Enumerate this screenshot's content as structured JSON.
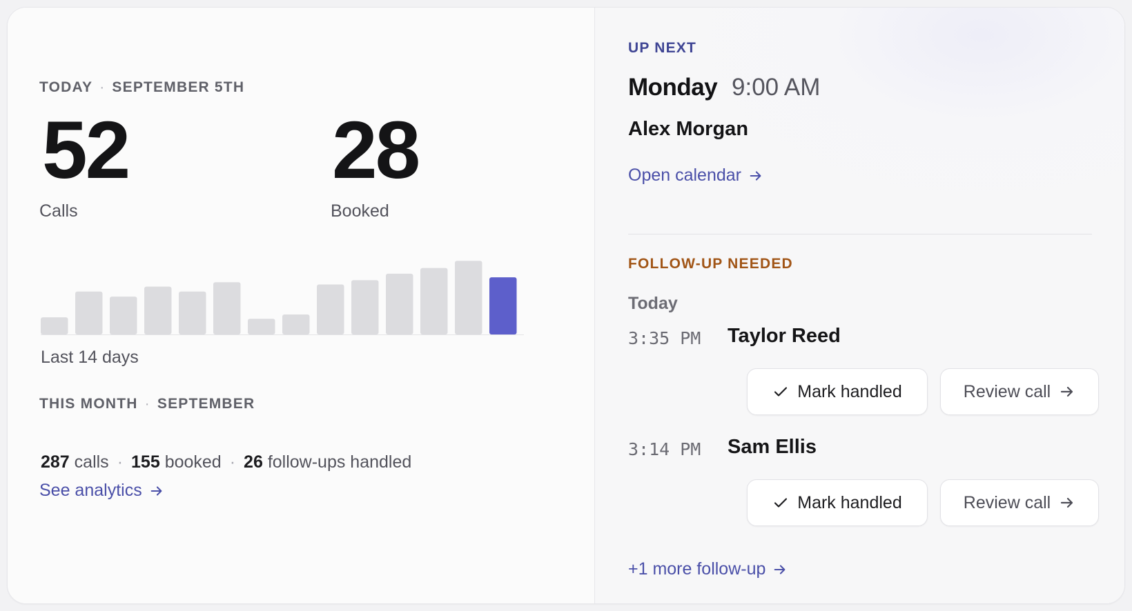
{
  "summary": {
    "today_label": "TODAY",
    "today_date": "SEPTEMBER 5TH",
    "calls_value": "52",
    "calls_label": "Calls",
    "booked_value": "28",
    "booked_label": "Booked",
    "chart_caption": "Last 14 days",
    "month_label": "THIS MONTH",
    "month_name": "SEPTEMBER",
    "month_calls_value": "287",
    "month_calls_label": "calls",
    "month_booked_value": "155",
    "month_booked_label": "booked",
    "month_followups_value": "26",
    "month_followups_label": "follow-ups handled",
    "analytics_link": "See analytics"
  },
  "chart_data": {
    "type": "bar",
    "categories": [],
    "values": [
      24,
      60,
      53,
      67,
      60,
      73,
      22,
      28,
      70,
      76,
      85,
      93,
      103,
      80
    ],
    "highlight_index": 13,
    "bar_color": "#dcdcdf",
    "highlight_color": "#5d5fcb",
    "ylim": [
      0,
      110
    ],
    "title": "",
    "xlabel": "",
    "ylabel": "",
    "grid": false
  },
  "up_next": {
    "label": "UP NEXT",
    "day": "Monday",
    "time": "9:00 AM",
    "person": "Alex Morgan",
    "calendar_link": "Open calendar"
  },
  "follow_up": {
    "label": "FOLLOW-UP NEEDED",
    "group": "Today",
    "items": [
      {
        "time": "3:35 PM",
        "name": "Taylor Reed",
        "mark_label": "Mark handled",
        "review_label": "Review call"
      },
      {
        "time": "3:14 PM",
        "name": "Sam Ellis",
        "mark_label": "Mark handled",
        "review_label": "Review call"
      }
    ],
    "more_link": "+1 more follow-up"
  },
  "colors": {
    "accent": "#4a4fa8",
    "followup_accent": "#a15516",
    "up_next_accent": "#3f4594"
  },
  "icons": {
    "arrow": "arrow-right-icon",
    "check": "check-icon"
  }
}
